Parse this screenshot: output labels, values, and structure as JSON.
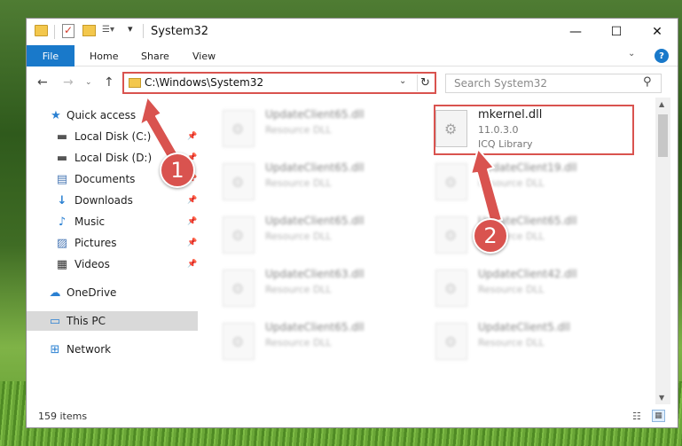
{
  "window": {
    "title": "System32",
    "minimize_glyph": "—",
    "maximize_glyph": "☐",
    "close_glyph": "✕"
  },
  "ribbon": {
    "tabs": [
      "File",
      "Home",
      "Share",
      "View"
    ],
    "expand_glyph": "⌄",
    "help_glyph": "?"
  },
  "toolbar": {
    "qa_view_glyph": "☰▾",
    "qa_dropdown_glyph": "▾"
  },
  "navigation": {
    "back_glyph": "←",
    "forward_glyph": "→",
    "recent_glyph": "⌄",
    "up_glyph": "↑",
    "address": "C:\\Windows\\System32",
    "address_dropdown_glyph": "⌄",
    "refresh_glyph": "↻",
    "search_placeholder": "Search System32",
    "search_glyph": "⚲"
  },
  "sidebar": {
    "items": [
      {
        "label": "Quick access",
        "icon": "star-icon",
        "glyph": "★",
        "color": "#2a80d2"
      },
      {
        "label": "Local Disk (C:)",
        "icon": "drive-icon",
        "glyph": "▬",
        "color": "#555555",
        "pinned": true
      },
      {
        "label": "Local Disk (D:)",
        "icon": "drive-icon",
        "glyph": "▬",
        "color": "#555555",
        "pinned": true
      },
      {
        "label": "Documents",
        "icon": "documents-icon",
        "glyph": "▤",
        "color": "#4a78b5",
        "pinned": true
      },
      {
        "label": "Downloads",
        "icon": "downloads-icon",
        "glyph": "↓",
        "color": "#2a80d2",
        "pinned": true
      },
      {
        "label": "Music",
        "icon": "music-icon",
        "glyph": "♪",
        "color": "#2a80d2",
        "pinned": true
      },
      {
        "label": "Pictures",
        "icon": "pictures-icon",
        "glyph": "▨",
        "color": "#4a78b5",
        "pinned": true
      },
      {
        "label": "Videos",
        "icon": "videos-icon",
        "glyph": "▦",
        "color": "#333333",
        "pinned": true
      },
      {
        "label": "OneDrive",
        "icon": "cloud-icon",
        "glyph": "☁",
        "color": "#2a80d2"
      },
      {
        "label": "This PC",
        "icon": "computer-icon",
        "glyph": "▭",
        "color": "#2a80d2",
        "selected": true
      },
      {
        "label": "Network",
        "icon": "network-icon",
        "glyph": "⊞",
        "color": "#2a80d2"
      }
    ],
    "pin_glyph": "📌"
  },
  "files": [
    {
      "name": "UpdateClient65.dll",
      "desc": "Resource DLL",
      "blurred": true
    },
    {
      "name": "mkernel.dll",
      "desc": "11.0.3.0",
      "desc2": "ICQ Library",
      "blurred": false
    },
    {
      "name": "UpdateClient65.dll",
      "desc": "Resource DLL",
      "blurred": true
    },
    {
      "name": "UpdateClient19.dll",
      "desc": "Resource DLL",
      "blurred": true
    },
    {
      "name": "UpdateClient65.dll",
      "desc": "Resource DLL",
      "blurred": true
    },
    {
      "name": "UpdateClient65.dll",
      "desc": "Resource DLL",
      "blurred": true
    },
    {
      "name": "UpdateClient63.dll",
      "desc": "Resource DLL",
      "blurred": true
    },
    {
      "name": "UpdateClient42.dll",
      "desc": "Resource DLL",
      "blurred": true
    },
    {
      "name": "UpdateClient65.dll",
      "desc": "Resource DLL",
      "blurred": true
    },
    {
      "name": "UpdateClient5.dll",
      "desc": "Resource DLL",
      "blurred": true
    }
  ],
  "file_icon_glyph": "⚙",
  "scrollbar": {
    "up_glyph": "▲",
    "down_glyph": "▼"
  },
  "status": {
    "items_count": "159 items",
    "details_glyph": "☷",
    "icons_glyph": "▦"
  },
  "annotations": {
    "badge_1": "1",
    "badge_2": "2",
    "color": "#d9534f"
  }
}
